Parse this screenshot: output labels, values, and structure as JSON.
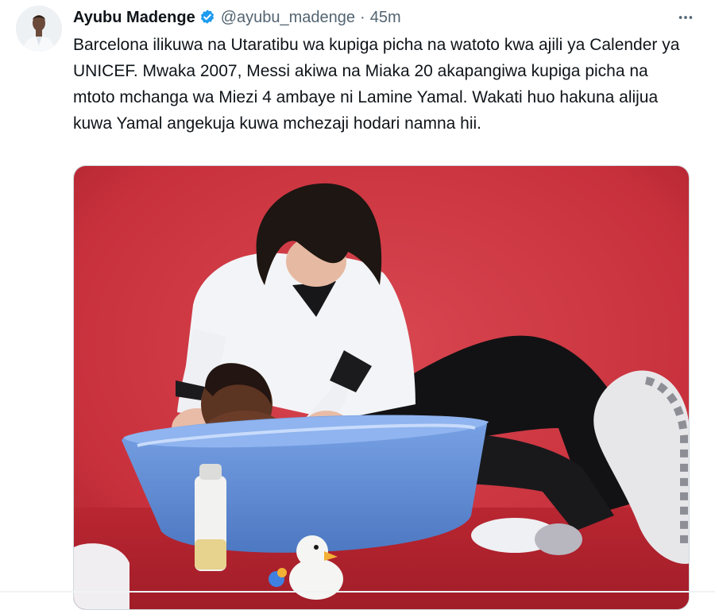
{
  "tweet": {
    "author_name": "Ayubu Madenge",
    "handle": "@ayubu_madenge",
    "separator": "·",
    "time": "45m",
    "text": "Barcelona ilikuwa na Utaratibu wa kupiga picha na watoto kwa ajili ya Calender ya UNICEF. Mwaka 2007, Messi akiwa na Miaka 20 akapangiwa kupiga picha na mtoto mchanga wa Miezi 4 ambaye ni Lamine Yamal. Wakati huo hakuna alijua kuwa Yamal angekuja kuwa mchezaji hodari namna hii.",
    "verified": true,
    "icons": {
      "verified": "verified-badge-icon",
      "more": "more-options-icon"
    }
  },
  "colors": {
    "verified_blue": "#1d9bf0",
    "text_primary": "#0f1419",
    "text_secondary": "#536471",
    "photo_background_red": "#c8313c"
  }
}
